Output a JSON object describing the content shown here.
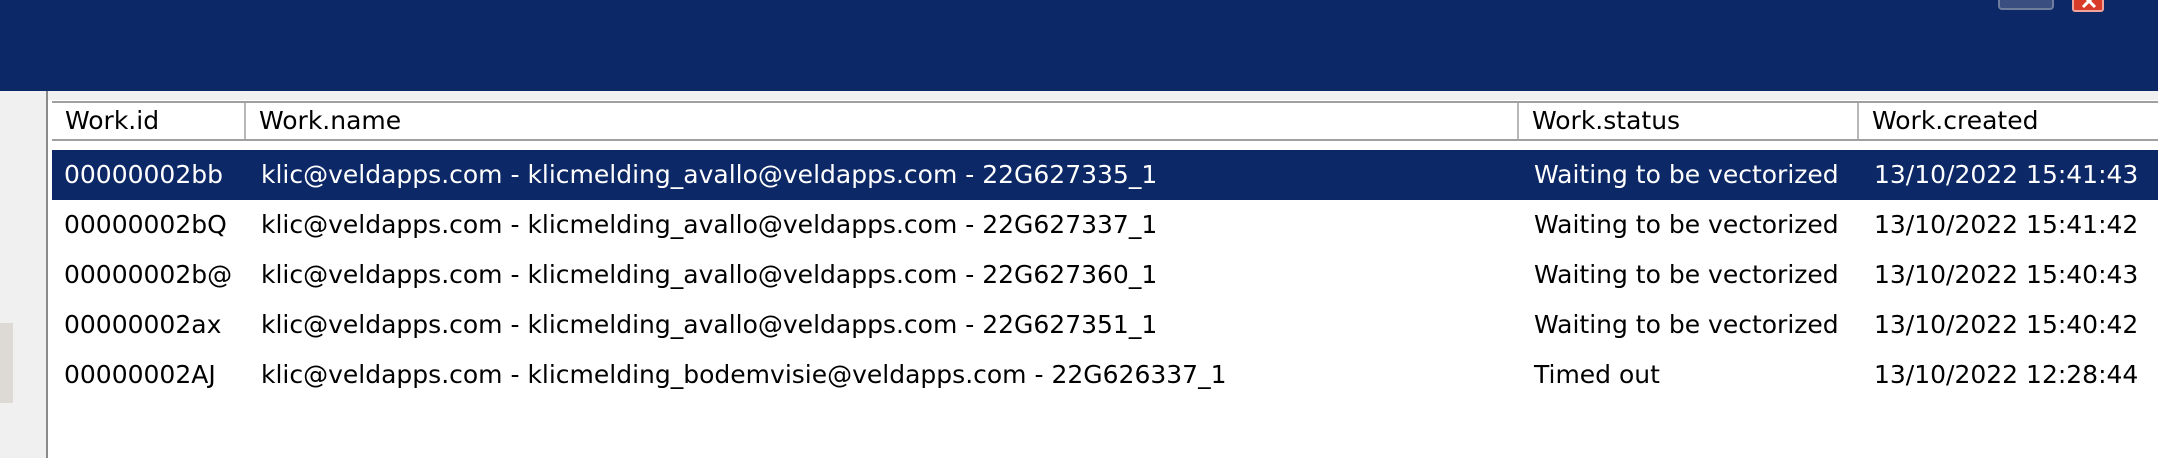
{
  "columns": [
    {
      "label": "Work.id"
    },
    {
      "label": "Work.name"
    },
    {
      "label": "Work.status"
    },
    {
      "label": "Work.created"
    }
  ],
  "rows": [
    {
      "id": "00000002bb",
      "name": "klic@veldapps.com - klicmelding_avallo@veldapps.com - 22G627335_1",
      "status": "Waiting to be vectorized",
      "created": "13/10/2022 15:41:43",
      "selected": true
    },
    {
      "id": "00000002bQ",
      "name": "klic@veldapps.com - klicmelding_avallo@veldapps.com - 22G627337_1",
      "status": "Waiting to be vectorized",
      "created": "13/10/2022 15:41:42"
    },
    {
      "id": "00000002b@",
      "name": "klic@veldapps.com - klicmelding_avallo@veldapps.com - 22G627360_1",
      "status": "Waiting to be vectorized",
      "created": "13/10/2022 15:40:43"
    },
    {
      "id": "00000002ax",
      "name": "klic@veldapps.com - klicmelding_avallo@veldapps.com - 22G627351_1",
      "status": "Waiting to be vectorized",
      "created": "13/10/2022 15:40:42"
    },
    {
      "id": "00000002AJ",
      "name": "klic@veldapps.com - klicmelding_bodemvisie@veldapps.com - 22G626337_1",
      "status": "Timed out",
      "created": "13/10/2022 12:28:44"
    }
  ],
  "colors": {
    "titlebar": "#0c2866",
    "selection": "#0c2866",
    "close_button": "#d93b2b"
  },
  "icons": {
    "restore": "window-restore-icon",
    "close": "window-close-icon"
  }
}
